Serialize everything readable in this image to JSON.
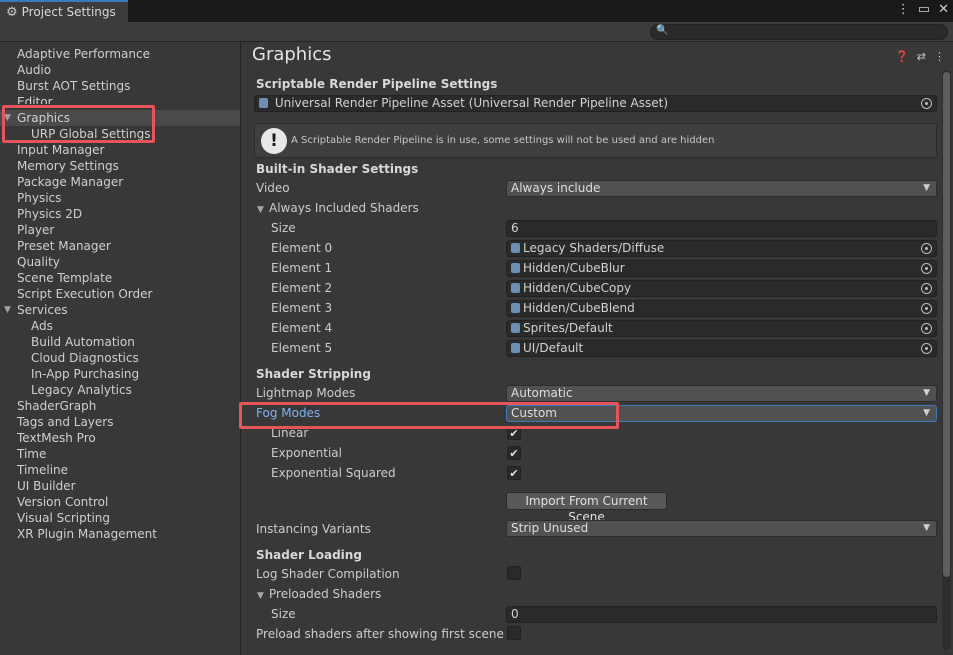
{
  "window": {
    "tab_title": "Project Settings",
    "icons": [
      "gear-icon",
      "kebab-menu-icon",
      "maximize-icon",
      "close-icon"
    ]
  },
  "search": {
    "value": "",
    "icon": "search-icon"
  },
  "sidebar": {
    "items": [
      {
        "label": "Adaptive Performance"
      },
      {
        "label": "Audio"
      },
      {
        "label": "Burst AOT Settings"
      },
      {
        "label": "Editor"
      },
      {
        "label": "Graphics",
        "selected": true,
        "expanded": true
      },
      {
        "label": "URP Global Settings",
        "child": true
      },
      {
        "label": "Input Manager"
      },
      {
        "label": "Memory Settings"
      },
      {
        "label": "Package Manager"
      },
      {
        "label": "Physics"
      },
      {
        "label": "Physics 2D"
      },
      {
        "label": "Player"
      },
      {
        "label": "Preset Manager"
      },
      {
        "label": "Quality"
      },
      {
        "label": "Scene Template"
      },
      {
        "label": "Script Execution Order"
      },
      {
        "label": "Services",
        "expanded": true
      },
      {
        "label": "Ads",
        "child": true
      },
      {
        "label": "Build Automation",
        "child": true
      },
      {
        "label": "Cloud Diagnostics",
        "child": true
      },
      {
        "label": "In-App Purchasing",
        "child": true
      },
      {
        "label": "Legacy Analytics",
        "child": true
      },
      {
        "label": "ShaderGraph"
      },
      {
        "label": "Tags and Layers"
      },
      {
        "label": "TextMesh Pro"
      },
      {
        "label": "Time"
      },
      {
        "label": "Timeline"
      },
      {
        "label": "UI Builder"
      },
      {
        "label": "Version Control"
      },
      {
        "label": "Visual Scripting"
      },
      {
        "label": "XR Plugin Management"
      }
    ]
  },
  "main": {
    "title": "Graphics",
    "header_icons": [
      "help-icon",
      "presets-icon",
      "kebab-menu-icon"
    ],
    "srp": {
      "section": "Scriptable Render Pipeline Settings",
      "asset": "Universal Render Pipeline Asset (Universal Render Pipeline Asset)",
      "warning": "A Scriptable Render Pipeline is in use, some settings will not be used and are hidden"
    },
    "builtin": {
      "section": "Built-in Shader Settings",
      "video_label": "Video",
      "video_value": "Always include",
      "always_included_label": "Always Included Shaders",
      "size_label": "Size",
      "size_value": "6",
      "elements": [
        {
          "label": "Element 0",
          "value": "Legacy Shaders/Diffuse"
        },
        {
          "label": "Element 1",
          "value": "Hidden/CubeBlur"
        },
        {
          "label": "Element 2",
          "value": "Hidden/CubeCopy"
        },
        {
          "label": "Element 3",
          "value": "Hidden/CubeBlend"
        },
        {
          "label": "Element 4",
          "value": "Sprites/Default"
        },
        {
          "label": "Element 5",
          "value": "UI/Default"
        }
      ]
    },
    "stripping": {
      "section": "Shader Stripping",
      "lightmap_label": "Lightmap Modes",
      "lightmap_value": "Automatic",
      "fog_label": "Fog Modes",
      "fog_value": "Custom",
      "linear_label": "Linear",
      "linear_checked": true,
      "exponential_label": "Exponential",
      "exponential_checked": true,
      "exp_squared_label": "Exponential Squared",
      "exp_squared_checked": true,
      "import_button": "Import From Current Scene",
      "instancing_label": "Instancing Variants",
      "instancing_value": "Strip Unused"
    },
    "loading": {
      "section": "Shader Loading",
      "log_label": "Log Shader Compilation",
      "log_checked": false,
      "preloaded_label": "Preloaded Shaders",
      "size_label": "Size",
      "size_value": "0",
      "preload_after_label": "Preload shaders after showing first scene",
      "preload_after_checked": false
    }
  },
  "glyphs": {
    "check": "✔",
    "caret": "▼",
    "fold_open": "▼"
  },
  "colors": {
    "highlight": "#e5555b",
    "accent": "#3a79bb",
    "active_label": "#7fb3f0"
  }
}
